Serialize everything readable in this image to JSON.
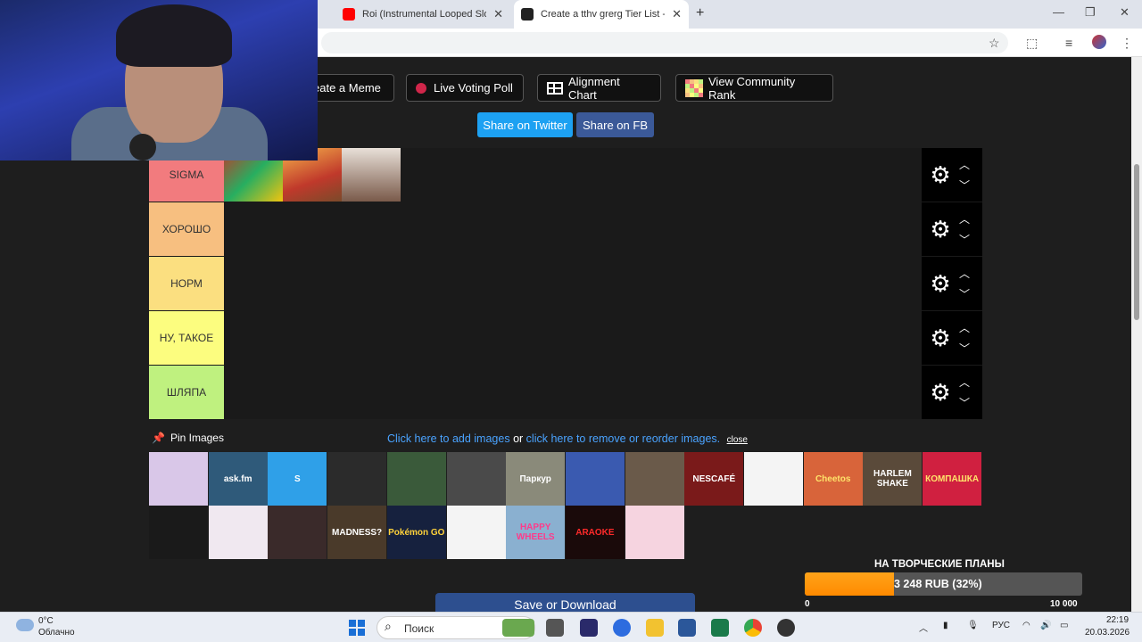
{
  "browser": {
    "tabs": [
      {
        "title": "Roi (Instrumental Looped Slowed",
        "favicon_color": "#ff0000"
      },
      {
        "title": "Create a tthv grerg Tier List - Ti",
        "favicon_color": "#222222"
      }
    ],
    "new_tab": "+",
    "window_controls": {
      "minimize": "—",
      "maximize": "❐",
      "close": "✕"
    }
  },
  "toolbar": {
    "meme_label": "eate a Meme",
    "voting_label": "Live Voting Poll",
    "alignment_label": "Alignment Chart",
    "community_label": "View Community Rank",
    "twitter_label": "Share on Twitter",
    "fb_label": "Share on FB"
  },
  "tiers": [
    {
      "label": "SIGMA",
      "color": "#f27b7e"
    },
    {
      "label": "ХОРОШО",
      "color": "#f7bf80"
    },
    {
      "label": "НОРМ",
      "color": "#fbdf80"
    },
    {
      "label": "НУ, ТАКОЕ",
      "color": "#fcfd7f"
    },
    {
      "label": "ШЛЯПА",
      "color": "#bff17f"
    }
  ],
  "tier_controls": {
    "gear": "⚙",
    "up": "︿",
    "down": "﹀"
  },
  "pin": {
    "label": "Pin Images"
  },
  "links": {
    "add": "Click here to add images",
    "or": "or",
    "remove": "click here to remove or reorder images.",
    "close": "close"
  },
  "pool_items": [
    {
      "name": "cd-disc-image",
      "text": "",
      "bg": "#d9c7e8",
      "fg": "#fff"
    },
    {
      "name": "askfm-logo-image",
      "text": "ask.fm",
      "bg": "#2f5a7a",
      "fg": "#ffffff"
    },
    {
      "name": "skype-logo-image",
      "text": "S",
      "bg": "#2fa0e8",
      "fg": "#ffffff"
    },
    {
      "name": "game-of-thrones-image",
      "text": "",
      "bg": "#2b2b2b",
      "fg": "#fff"
    },
    {
      "name": "nfs-underground-image",
      "text": "",
      "bg": "#3a5a3a",
      "fg": "#fff"
    },
    {
      "name": "nfs-most-wanted-image",
      "text": "",
      "bg": "#4a4a4a",
      "fg": "#fff"
    },
    {
      "name": "parkour-cat-image",
      "text": "Паркур",
      "bg": "#8a8a7a",
      "fg": "#ffffff"
    },
    {
      "name": "payment-terminal-image",
      "text": "",
      "bg": "#3a5ab0",
      "fg": "#fff"
    },
    {
      "name": "gta-san-andreas-image",
      "text": "",
      "bg": "#6a5a4a",
      "fg": "#fff"
    },
    {
      "name": "nescafe-image",
      "text": "NESCAFÉ",
      "bg": "#7a1a1a",
      "fg": "#ffffff"
    },
    {
      "name": "3d-glasses-image",
      "text": "",
      "bg": "#f4f4f4",
      "fg": "#fff"
    },
    {
      "name": "cheetos-image",
      "text": "Cheetos",
      "bg": "#d8643a",
      "fg": "#ffe36a"
    },
    {
      "name": "harlem-shake-image",
      "text": "HARLEM SHAKE",
      "bg": "#5a4a3a",
      "fg": "#ffffff"
    },
    {
      "name": "kompashka-image",
      "text": "КОМПАШКА",
      "bg": "#d02040",
      "fg": "#ffe36a"
    },
    {
      "name": "code-editor-image",
      "text": "",
      "bg": "#1a1a1a",
      "fg": "#fff"
    },
    {
      "name": "tamagotchi-image",
      "text": "",
      "bg": "#f0e8f0",
      "fg": "#fff"
    },
    {
      "name": "man-portrait-image",
      "text": "",
      "bg": "#3a2a2a",
      "fg": "#fff"
    },
    {
      "name": "this-is-sparta-image",
      "text": "MADNESS?",
      "bg": "#4a3a2a",
      "fg": "#ffffff"
    },
    {
      "name": "pokemon-go-image",
      "text": "Pokémon GO",
      "bg": "#16213e",
      "fg": "#ffd23a"
    },
    {
      "name": "fidget-spinner-image",
      "text": "",
      "bg": "#f4f4f4",
      "fg": "#fff"
    },
    {
      "name": "happy-wheels-image",
      "text": "HAPPY WHEELS",
      "bg": "#8ab0d0",
      "fg": "#ff3a8a"
    },
    {
      "name": "karaoke-sign-image",
      "text": "ARAOKE",
      "bg": "#1a0a0a",
      "fg": "#ff2a2a"
    },
    {
      "name": "pink-plush-image",
      "text": "",
      "bg": "#f6d4e0",
      "fg": "#fff"
    }
  ],
  "save": {
    "label": "Save or Download"
  },
  "donation": {
    "title": "НА ТВОРЧЕСКИЕ ПЛАНЫ",
    "amount": "3 248 RUB (32%)",
    "progress": 0.32,
    "min": "0",
    "max": "10 000"
  },
  "taskbar": {
    "temperature": "0°C",
    "condition": "Облачно",
    "search": "Поиск",
    "language": "РУС",
    "time": "22:19",
    "date": "20.03.2026"
  }
}
